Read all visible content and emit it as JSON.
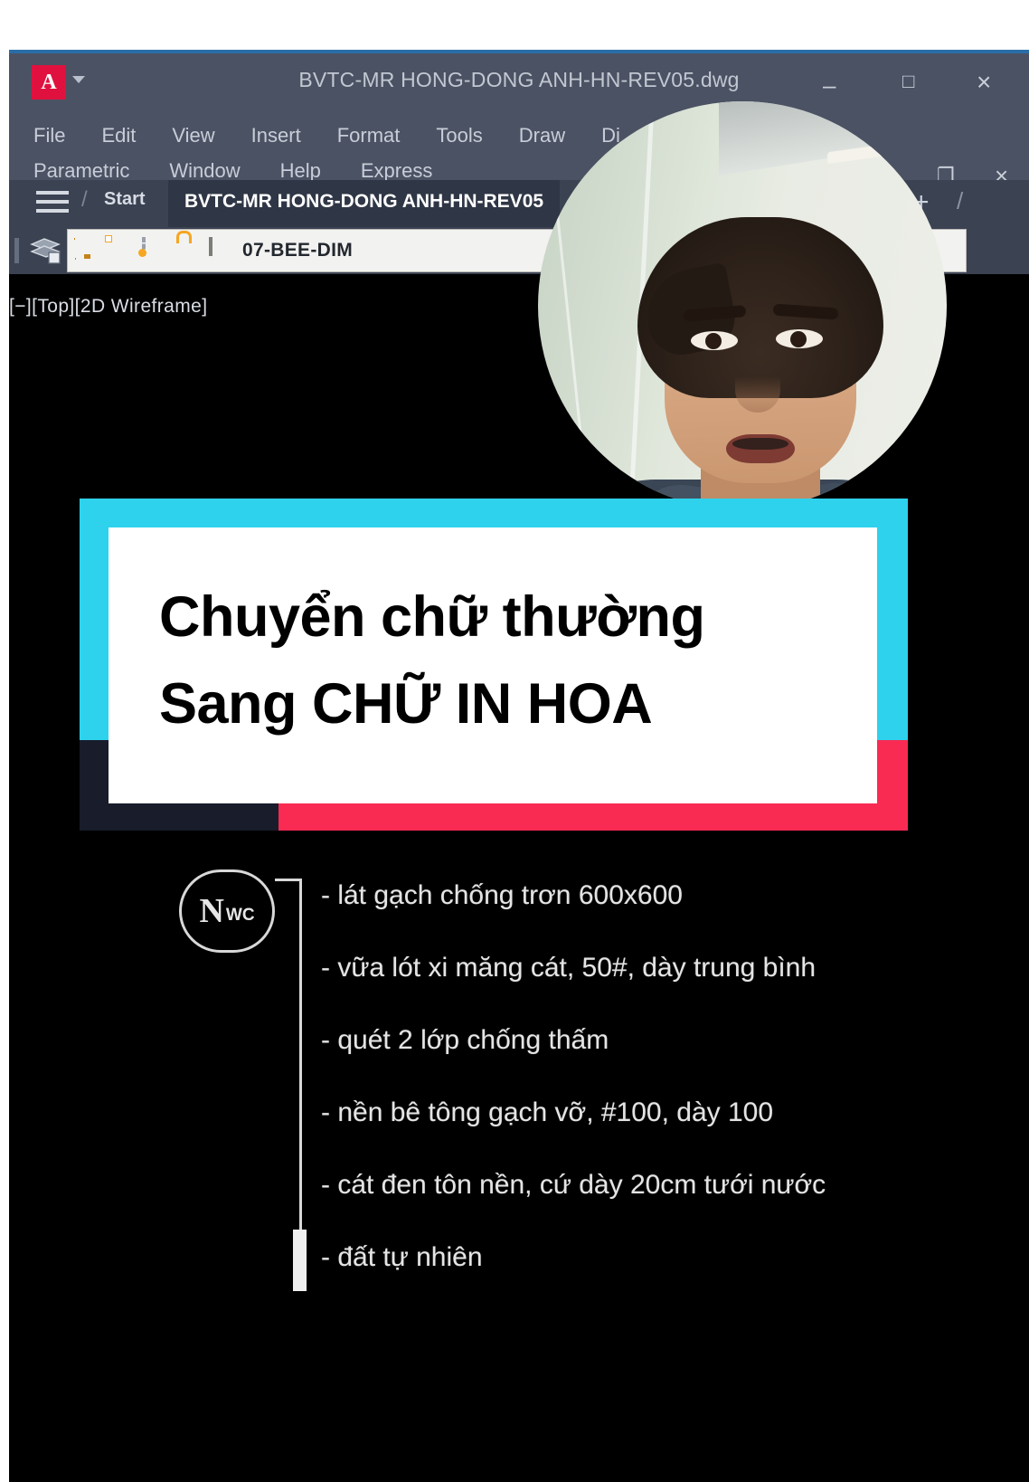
{
  "app": {
    "logo_letter": "A",
    "document_title": "BVTC-MR HONG-DONG ANH-HN-REV05.dwg",
    "window_controls": {
      "minimize": "–",
      "maximize": "□",
      "close": "×",
      "mdi_minimize": "–",
      "mdi_restore": "❐",
      "mdi_close": "×"
    }
  },
  "menu": {
    "row1": [
      "File",
      "Edit",
      "View",
      "Insert",
      "Format",
      "Tools",
      "Draw",
      "Di"
    ],
    "row2": [
      "Parametric",
      "Window",
      "Help",
      "Express"
    ]
  },
  "tabs": {
    "slash": "/",
    "start_label": "Start",
    "active_label": "BVTC-MR HONG-DONG ANH-HN-REV05",
    "new_tab": "+",
    "trailing_slash": "/"
  },
  "layer_toolbar": {
    "layer_name": "07-BEE-DIM",
    "icons": [
      "lightbulb-on-icon",
      "sun-icon",
      "freeze-icon",
      "unlock-icon",
      "color-swatch-icon"
    ]
  },
  "viewport": {
    "label": "[−][Top][2D Wireframe]"
  },
  "drawing": {
    "bubble": {
      "number": "N",
      "suffix": "WC"
    },
    "annotations": [
      "- lát gạch chống trơn 600x600",
      "- vữa lót xi măng cát, 50#, dày trung bình",
      "- quét 2 lớp chống thấm",
      "- nền bê tông gạch vỡ, #100, dày 100",
      "- cát đen tôn nền, cứ dày 20cm tưới nước",
      "- đất tự nhiên"
    ]
  },
  "overlay": {
    "title_line1": "Chuyển chữ thường",
    "title_line2": "Sang CHỮ IN HOA",
    "colors": {
      "cyan": "#2ed2ec",
      "navy": "#181c2b",
      "red": "#f92b53",
      "card": "#ffffff",
      "text": "#000000"
    }
  },
  "webcam": {
    "label": "presenter-video-circle"
  }
}
